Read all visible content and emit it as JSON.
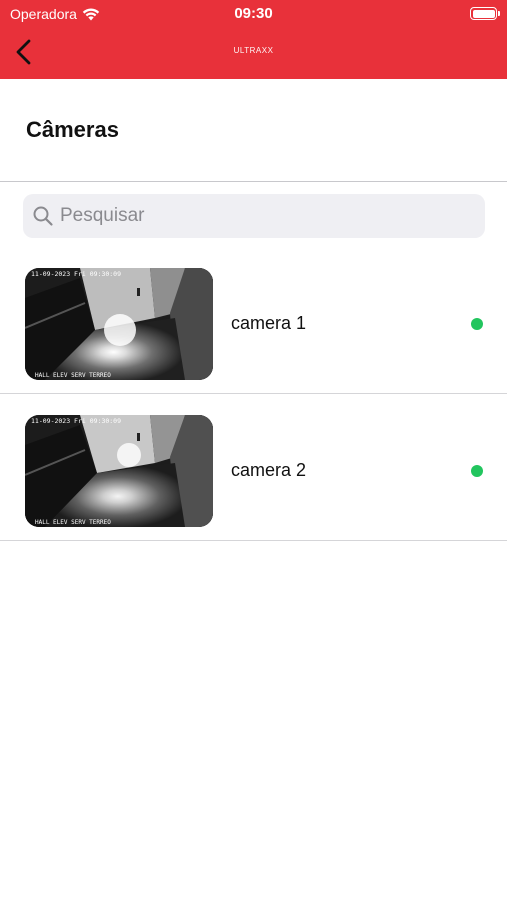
{
  "status_bar": {
    "carrier": "Operadora",
    "time": "09:30"
  },
  "nav": {
    "brand": "ULTRAXX",
    "back_icon": "chevron-left-icon"
  },
  "page": {
    "title": "Câmeras"
  },
  "search": {
    "placeholder": "Pesquisar",
    "value": "",
    "icon": "search-icon"
  },
  "cameras": [
    {
      "name": "camera 1",
      "overlay_top": "11-09-2023 Fri 09:30:09",
      "overlay_bottom": "HALL ELEV SERV TERREO",
      "status_color": "#22c55e"
    },
    {
      "name": "camera 2",
      "overlay_top": "11-09-2023 Fri 09:30:09",
      "overlay_bottom": "HALL ELEV SERV TERREO",
      "status_color": "#22c55e"
    }
  ],
  "colors": {
    "accent": "#e8313a",
    "online": "#22c55e"
  }
}
